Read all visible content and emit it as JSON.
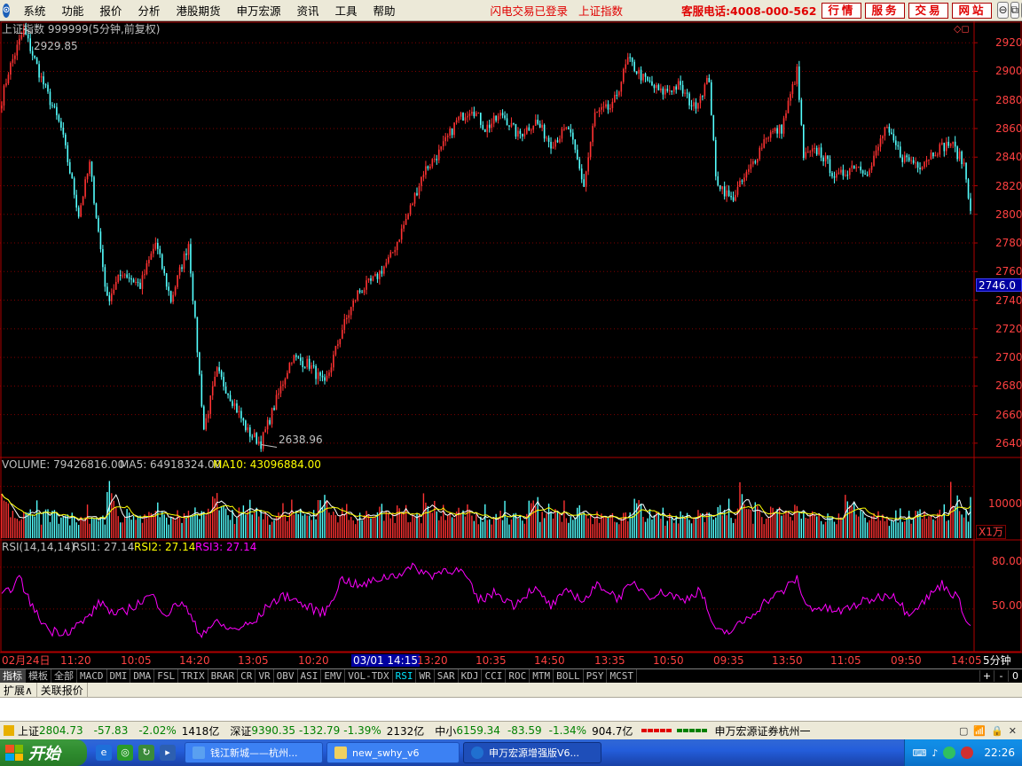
{
  "menubar": {
    "logo_glyph": "⊙",
    "menus": [
      "系统",
      "功能",
      "报价",
      "分析",
      "港股期货",
      "申万宏源",
      "资讯",
      "工具",
      "帮助"
    ],
    "status_login": "闪电交易已登录",
    "status_index": "上证指数",
    "phone": "客服电话:4008-000-562",
    "nav_buttons": [
      "行情",
      "服务",
      "交易",
      "网站"
    ]
  },
  "chart": {
    "header_title": "上证指数 999999(5分钟,前复权)",
    "high_label": "2929.85",
    "low_label": "2638.96",
    "price_ticks": [
      "2920",
      "2900",
      "2880",
      "2860",
      "2840",
      "2820",
      "2800",
      "2780",
      "2760",
      "2740",
      "2720",
      "2700",
      "2680",
      "2660",
      "2640"
    ],
    "current_price": "2746.0",
    "volume_header": {
      "vol": "VOLUME: 79426816.00",
      "ma5": "MA5: 64918324.00",
      "ma10": "MA10: 43096884.00"
    },
    "volume_tick": "10000",
    "volume_unit": "X1万",
    "rsi_header": {
      "params": "RSI(14,14,14)",
      "rsi1": "RSI1: 27.14",
      "rsi2": "RSI2: 27.14",
      "rsi3": "RSI3: 27.14"
    },
    "rsi_ticks": [
      "80.00",
      "50.00"
    ],
    "time_axis": [
      "02月24日",
      "11:20",
      "10:05",
      "14:20",
      "13:05",
      "10:20",
      "03/01 14:15",
      "13:20",
      "10:35",
      "14:50",
      "13:35",
      "10:50",
      "09:35",
      "13:50",
      "11:05",
      "09:50",
      "14:05"
    ],
    "period_label": "5分钟",
    "colors": {
      "up": "#ff3232",
      "down": "#54ffff",
      "ma5": "#ffffff",
      "ma10": "#ffff00",
      "rsi": "#ff00ff",
      "grid": "#800000",
      "axis": "#b00000"
    }
  },
  "chart_data": {
    "type": "candlestick",
    "title": "上证指数 999999(5分钟,前复权)",
    "price_range": [
      2630,
      2935
    ],
    "high": 2929.85,
    "low": 2638.96,
    "last": 2746.0,
    "price_anchors": [
      [
        0,
        2880
      ],
      [
        3,
        2900
      ],
      [
        10,
        2929
      ],
      [
        18,
        2895
      ],
      [
        27,
        2860
      ],
      [
        35,
        2800
      ],
      [
        40,
        2835
      ],
      [
        48,
        2740
      ],
      [
        55,
        2760
      ],
      [
        63,
        2750
      ],
      [
        70,
        2780
      ],
      [
        77,
        2740
      ],
      [
        85,
        2780
      ],
      [
        92,
        2650
      ],
      [
        98,
        2690
      ],
      [
        105,
        2670
      ],
      [
        112,
        2648
      ],
      [
        118,
        2640
      ],
      [
        125,
        2670
      ],
      [
        132,
        2700
      ],
      [
        140,
        2695
      ],
      [
        147,
        2680
      ],
      [
        155,
        2720
      ],
      [
        162,
        2745
      ],
      [
        170,
        2755
      ],
      [
        177,
        2770
      ],
      [
        185,
        2800
      ],
      [
        192,
        2830
      ],
      [
        200,
        2845
      ],
      [
        207,
        2865
      ],
      [
        214,
        2875
      ],
      [
        220,
        2860
      ],
      [
        228,
        2870
      ],
      [
        235,
        2855
      ],
      [
        243,
        2865
      ],
      [
        250,
        2850
      ],
      [
        258,
        2860
      ],
      [
        265,
        2820
      ],
      [
        270,
        2870
      ],
      [
        278,
        2875
      ],
      [
        285,
        2908
      ],
      [
        292,
        2895
      ],
      [
        300,
        2885
      ],
      [
        308,
        2890
      ],
      [
        315,
        2875
      ],
      [
        322,
        2895
      ],
      [
        325,
        2825
      ],
      [
        332,
        2810
      ],
      [
        340,
        2830
      ],
      [
        348,
        2855
      ],
      [
        355,
        2860
      ],
      [
        362,
        2900
      ],
      [
        365,
        2840
      ],
      [
        372,
        2845
      ],
      [
        380,
        2825
      ],
      [
        388,
        2835
      ],
      [
        395,
        2830
      ],
      [
        402,
        2860
      ],
      [
        410,
        2840
      ],
      [
        418,
        2835
      ],
      [
        425,
        2845
      ],
      [
        432,
        2850
      ],
      [
        438,
        2835
      ],
      [
        441,
        2805
      ]
    ],
    "volume_range": [
      0,
      12500
    ],
    "rsi_range": [
      20,
      90
    ],
    "rsi_anchors": [
      [
        0,
        58
      ],
      [
        8,
        72
      ],
      [
        15,
        48
      ],
      [
        22,
        34
      ],
      [
        30,
        34
      ],
      [
        38,
        42
      ],
      [
        45,
        55
      ],
      [
        52,
        45
      ],
      [
        60,
        52
      ],
      [
        68,
        60
      ],
      [
        75,
        46
      ],
      [
        82,
        56
      ],
      [
        90,
        32
      ],
      [
        97,
        40
      ],
      [
        105,
        35
      ],
      [
        115,
        40
      ],
      [
        122,
        54
      ],
      [
        130,
        60
      ],
      [
        138,
        52
      ],
      [
        147,
        47
      ],
      [
        155,
        72
      ],
      [
        163,
        66
      ],
      [
        172,
        72
      ],
      [
        180,
        75
      ],
      [
        188,
        80
      ],
      [
        195,
        74
      ],
      [
        203,
        79
      ],
      [
        210,
        76
      ],
      [
        217,
        56
      ],
      [
        225,
        62
      ],
      [
        233,
        53
      ],
      [
        242,
        65
      ],
      [
        250,
        52
      ],
      [
        258,
        63
      ],
      [
        265,
        56
      ],
      [
        272,
        68
      ],
      [
        280,
        58
      ],
      [
        288,
        68
      ],
      [
        295,
        60
      ],
      [
        303,
        62
      ],
      [
        310,
        56
      ],
      [
        318,
        64
      ],
      [
        325,
        33
      ],
      [
        332,
        34
      ],
      [
        340,
        44
      ],
      [
        348,
        56
      ],
      [
        355,
        62
      ],
      [
        362,
        72
      ],
      [
        366,
        52
      ],
      [
        375,
        50
      ],
      [
        382,
        48
      ],
      [
        390,
        54
      ],
      [
        398,
        58
      ],
      [
        406,
        61
      ],
      [
        412,
        47
      ],
      [
        420,
        56
      ],
      [
        428,
        68
      ],
      [
        435,
        58
      ],
      [
        441,
        37
      ]
    ]
  },
  "bottom": {
    "indicator_tabs": [
      "指标",
      "模板",
      "全部",
      "MACD",
      "DMI",
      "DMA",
      "FSL",
      "TRIX",
      "BRAR",
      "CR",
      "VR",
      "OBV",
      "ASI",
      "EMV",
      "VOL-TDX",
      "RSI",
      "WR",
      "SAR",
      "KDJ",
      "CCI",
      "ROC",
      "MTM",
      "BOLL",
      "PSY",
      "MCST"
    ],
    "selected_tab": "RSI",
    "arrows": [
      "+",
      "-",
      "0"
    ],
    "sub_tabs": [
      "扩展∧",
      "关联报价"
    ]
  },
  "ticker": {
    "sh_name": "上证",
    "sh_price": "2804.73",
    "sh_chg": "-57.83",
    "sh_pct": "-2.02%",
    "sh_amt": "1418亿",
    "sz_name": "深证",
    "sz_price": "9390.35",
    "sz_chg": "-132.79",
    "sz_pct": "-1.39%",
    "sz_amt": "2132亿",
    "zx_name": "中小",
    "zx_price": "6159.34",
    "zx_chg": "-83.59",
    "zx_pct": "-1.34%",
    "zx_amt": "904.7亿",
    "broker": "申万宏源证券杭州一"
  },
  "taskbar": {
    "start_label": "开始",
    "tasks": [
      "钱江新城——杭州...",
      "new_swhy_v6",
      "申万宏源增强版V6..."
    ],
    "clock": "22:26"
  }
}
